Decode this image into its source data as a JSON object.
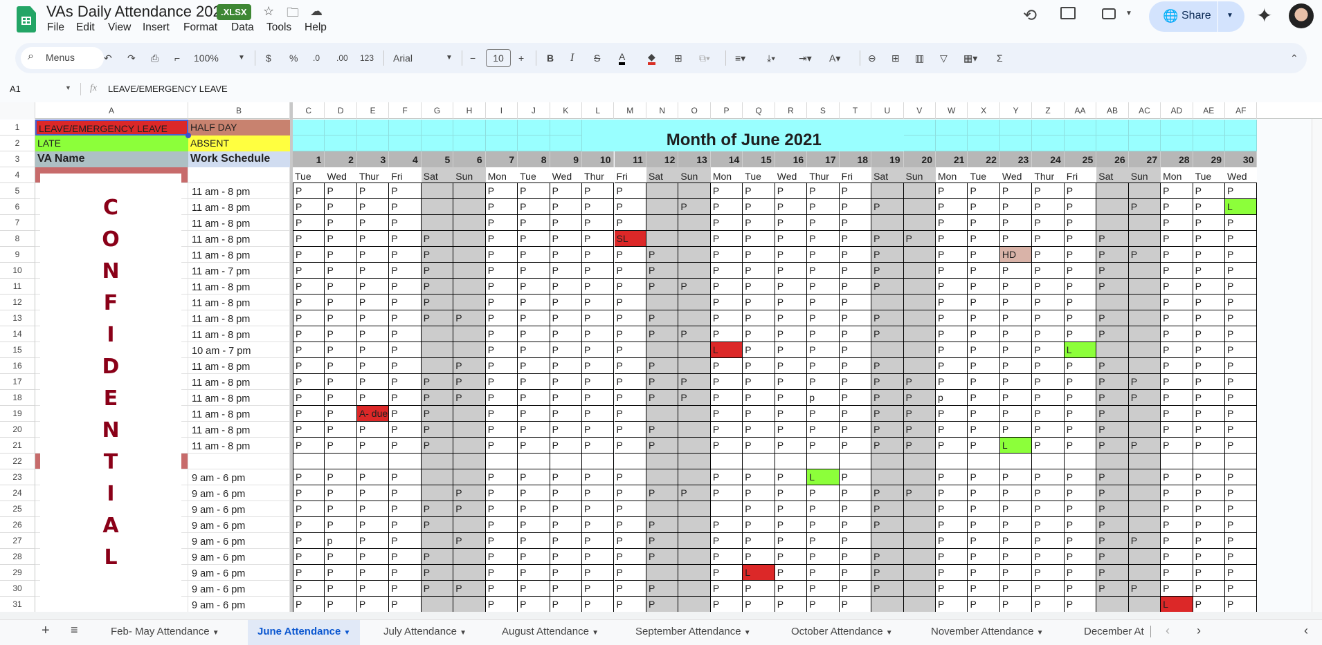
{
  "app": {
    "title": "VAs Daily Attendance 2021",
    "badge": ".XLSX",
    "menus": [
      "File",
      "Edit",
      "View",
      "Insert",
      "Format",
      "Data",
      "Tools",
      "Help"
    ],
    "share_label": "Share"
  },
  "toolbar": {
    "search_label": "Menus",
    "zoom": "100%",
    "currency": "$",
    "percent": "%",
    "decrease_decimal": ".0",
    "increase_decimal": ".00",
    "number_format": "123",
    "font": "Arial",
    "font_size": "10",
    "text_color": "#000000",
    "fill_color": "#d93025"
  },
  "formula_bar": {
    "cell_ref": "A1",
    "fx": "fx",
    "content": "LEAVE/EMERGENCY LEAVE"
  },
  "sheet": {
    "columns": [
      "A",
      "B",
      "C",
      "D",
      "E",
      "F",
      "G",
      "H",
      "I",
      "J",
      "K",
      "L",
      "M",
      "N",
      "O",
      "P",
      "Q",
      "R",
      "S",
      "T",
      "U",
      "V",
      "W",
      "X",
      "Y",
      "Z",
      "AA",
      "AB",
      "AC",
      "AD",
      "AE",
      "AF"
    ],
    "row_numbers": [
      "1",
      "2",
      "3",
      "4",
      "5",
      "6",
      "7",
      "8",
      "9",
      "10",
      "11",
      "12",
      "13",
      "14",
      "15",
      "16",
      "17",
      "18",
      "19",
      "20",
      "21",
      "22",
      "23",
      "24",
      "25",
      "26",
      "27",
      "28",
      "29",
      "30",
      "31"
    ],
    "legend": {
      "a1": "LEAVE/EMERGENCY LEAVE",
      "b1": "HALF DAY",
      "a2": "LATE",
      "b2": "ABSENT"
    },
    "headers": {
      "va_name": "VA Name",
      "work_schedule": "Work Schedule"
    },
    "title": "Month of June 2021",
    "days": [
      "1",
      "2",
      "3",
      "4",
      "5",
      "6",
      "7",
      "8",
      "9",
      "10",
      "11",
      "12",
      "13",
      "14",
      "15",
      "16",
      "17",
      "18",
      "19",
      "20",
      "21",
      "22",
      "23",
      "24",
      "25",
      "26",
      "27",
      "28",
      "29",
      "30"
    ],
    "weekdays": [
      "Tue",
      "Wed",
      "Thur",
      "Fri",
      "Sat",
      "Sun",
      "Mon",
      "Tue",
      "Wed",
      "Thur",
      "Fri",
      "Sat",
      "Sun",
      "Mon",
      "Tue",
      "Wed",
      "Thur",
      "Fri",
      "Sat",
      "Sun",
      "Mon",
      "Tue",
      "Wed",
      "Thur",
      "Fri",
      "Sat",
      "Sun",
      "Mon",
      "Tue",
      "Wed"
    ],
    "schedules": [
      "",
      "11 am - 8 pm",
      "11 am - 8 pm",
      "11 am - 8 pm",
      "11 am - 8 pm",
      "11 am - 8 pm",
      "11 am - 7 pm",
      "11 am - 8 pm",
      "11 am - 8 pm",
      "11 am - 8 pm",
      "11 am - 8 pm",
      "10 am - 7 pm",
      "11 am - 8 pm",
      "11 am - 8 pm",
      "11 am - 8 pm",
      "11 am - 8 pm",
      "11 am - 8 pm",
      "11 am - 8 pm",
      "",
      "9 am - 6 pm",
      "9 am - 6 pm",
      "9 am - 6 pm",
      "9 am - 6 pm",
      "9 am - 6 pm",
      "9 am - 6 pm",
      "9 am - 6 pm",
      "9 am - 6 pm",
      "9 am - 6 pm"
    ],
    "attendance": [
      [
        "P",
        "P",
        "P",
        "P",
        "",
        "",
        "P",
        "P",
        "P",
        "P",
        "P",
        "",
        "",
        "P",
        "P",
        "P",
        "P",
        "P",
        "",
        "",
        "P",
        "P",
        "P",
        "P",
        "P",
        "",
        "",
        "P",
        "P",
        "P"
      ],
      [
        "P",
        "P",
        "P",
        "P",
        "",
        "",
        "P",
        "P",
        "P",
        "P",
        "P",
        "",
        "P",
        "P",
        "P",
        "P",
        "P",
        "P",
        "P",
        "",
        "P",
        "P",
        "P",
        "P",
        "P",
        "",
        "P",
        "P",
        "P",
        "L"
      ],
      [
        "P",
        "P",
        "P",
        "P",
        "",
        "",
        "P",
        "P",
        "P",
        "P",
        "P",
        "",
        "",
        "P",
        "P",
        "P",
        "P",
        "P",
        "",
        "",
        "P",
        "P",
        "P",
        "P",
        "P",
        "",
        "",
        "P",
        "P",
        "P"
      ],
      [
        "P",
        "P",
        "P",
        "P",
        "P",
        "",
        "P",
        "P",
        "P",
        "P",
        "SL",
        "",
        "",
        "P",
        "P",
        "P",
        "P",
        "P",
        "P",
        "P",
        "P",
        "P",
        "P",
        "P",
        "P",
        "P",
        "",
        "P",
        "P",
        "P"
      ],
      [
        "P",
        "P",
        "P",
        "P",
        "P",
        "",
        "P",
        "P",
        "P",
        "P",
        "P",
        "P",
        "",
        "P",
        "P",
        "P",
        "P",
        "P",
        "P",
        "",
        "P",
        "P",
        "HD",
        "P",
        "P",
        "P",
        "P",
        "P",
        "P",
        "P"
      ],
      [
        "P",
        "P",
        "P",
        "P",
        "P",
        "",
        "P",
        "P",
        "P",
        "P",
        "P",
        "P",
        "",
        "P",
        "P",
        "P",
        "P",
        "P",
        "P",
        "",
        "P",
        "P",
        "P",
        "P",
        "P",
        "P",
        "",
        "P",
        "P",
        "P"
      ],
      [
        "P",
        "P",
        "P",
        "P",
        "P",
        "",
        "P",
        "P",
        "P",
        "P",
        "P",
        "P",
        "P",
        "P",
        "P",
        "P",
        "P",
        "P",
        "P",
        "",
        "P",
        "P",
        "P",
        "P",
        "P",
        "P",
        "",
        "P",
        "P",
        "P"
      ],
      [
        "P",
        "P",
        "P",
        "P",
        "P",
        "",
        "P",
        "P",
        "P",
        "P",
        "P",
        "",
        "",
        "P",
        "P",
        "P",
        "P",
        "P",
        "",
        "",
        "P",
        "P",
        "P",
        "P",
        "P",
        "",
        "",
        "P",
        "P",
        "P"
      ],
      [
        "P",
        "P",
        "P",
        "P",
        "P",
        "P",
        "P",
        "P",
        "P",
        "P",
        "P",
        "P",
        "",
        "P",
        "P",
        "P",
        "P",
        "P",
        "P",
        "",
        "P",
        "P",
        "P",
        "P",
        "P",
        "P",
        "",
        "P",
        "P",
        "P"
      ],
      [
        "P",
        "P",
        "P",
        "P",
        "",
        "",
        "P",
        "P",
        "P",
        "P",
        "P",
        "P",
        "P",
        "P",
        "P",
        "P",
        "P",
        "P",
        "P",
        "",
        "P",
        "P",
        "P",
        "P",
        "P",
        "P",
        "",
        "P",
        "P",
        "P"
      ],
      [
        "P",
        "P",
        "P",
        "P",
        "",
        "",
        "P",
        "P",
        "P",
        "P",
        "P",
        "",
        "",
        "L",
        "P",
        "P",
        "P",
        "P",
        "",
        "",
        "P",
        "P",
        "P",
        "P",
        "L",
        "",
        "",
        "P",
        "P",
        "P"
      ],
      [
        "P",
        "P",
        "P",
        "P",
        "",
        "P",
        "P",
        "P",
        "P",
        "P",
        "P",
        "P",
        "",
        "P",
        "P",
        "P",
        "P",
        "P",
        "P",
        "",
        "P",
        "P",
        "P",
        "P",
        "P",
        "P",
        "",
        "P",
        "P",
        "P"
      ],
      [
        "P",
        "P",
        "P",
        "P",
        "P",
        "P",
        "P",
        "P",
        "P",
        "P",
        "P",
        "P",
        "P",
        "P",
        "P",
        "P",
        "P",
        "P",
        "P",
        "P",
        "P",
        "P",
        "P",
        "P",
        "P",
        "P",
        "P",
        "P",
        "P",
        "P"
      ],
      [
        "P",
        "P",
        "P",
        "P",
        "P",
        "P",
        "P",
        "P",
        "P",
        "P",
        "P",
        "P",
        "P",
        "P",
        "P",
        "P",
        "p",
        "P",
        "P",
        "P",
        "p",
        "P",
        "P",
        "P",
        "P",
        "P",
        "P",
        "P",
        "P",
        "P"
      ],
      [
        "P",
        "P",
        "A- due",
        "P",
        "P",
        "",
        "P",
        "P",
        "P",
        "P",
        "P",
        "",
        "",
        "P",
        "P",
        "P",
        "P",
        "P",
        "P",
        "P",
        "P",
        "P",
        "P",
        "P",
        "P",
        "P",
        "",
        "P",
        "P",
        "P"
      ],
      [
        "P",
        "P",
        "P",
        "P",
        "P",
        "",
        "P",
        "P",
        "P",
        "P",
        "P",
        "P",
        "",
        "P",
        "P",
        "P",
        "P",
        "P",
        "P",
        "P",
        "P",
        "P",
        "P",
        "P",
        "P",
        "P",
        "",
        "P",
        "P",
        "P"
      ],
      [
        "P",
        "P",
        "P",
        "P",
        "P",
        "",
        "P",
        "P",
        "P",
        "P",
        "P",
        "P",
        "",
        "P",
        "P",
        "P",
        "P",
        "P",
        "P",
        "P",
        "P",
        "P",
        "L",
        "P",
        "P",
        "P",
        "P",
        "P",
        "P",
        "P"
      ],
      [
        "",
        "",
        "",
        "",
        "",
        "",
        "",
        "",
        "",
        "",
        "",
        "",
        "",
        "",
        "",
        "",
        "",
        "",
        "",
        "",
        "",
        "",
        "",
        "",
        "",
        "",
        "",
        "",
        "",
        ""
      ],
      [
        "P",
        "P",
        "P",
        "P",
        "",
        "",
        "P",
        "P",
        "P",
        "P",
        "P",
        "",
        "",
        "P",
        "P",
        "P",
        "L",
        "P",
        "",
        "",
        "P",
        "P",
        "P",
        "P",
        "P",
        "P",
        "",
        "P",
        "P",
        "P"
      ],
      [
        "P",
        "P",
        "P",
        "P",
        "",
        "P",
        "P",
        "P",
        "P",
        "P",
        "P",
        "P",
        "P",
        "P",
        "P",
        "P",
        "P",
        "P",
        "P",
        "P",
        "P",
        "P",
        "P",
        "P",
        "P",
        "P",
        "",
        "P",
        "P",
        "P"
      ],
      [
        "P",
        "P",
        "P",
        "P",
        "P",
        "P",
        "P",
        "P",
        "P",
        "P",
        "P",
        "",
        "",
        "",
        "P",
        "P",
        "P",
        "P",
        "P",
        "",
        "P",
        "P",
        "P",
        "P",
        "P",
        "P",
        "",
        "P",
        "P",
        "P"
      ],
      [
        "P",
        "P",
        "P",
        "P",
        "P",
        "",
        "P",
        "P",
        "P",
        "P",
        "P",
        "P",
        "",
        "P",
        "P",
        "P",
        "P",
        "P",
        "P",
        "",
        "P",
        "P",
        "P",
        "P",
        "P",
        "P",
        "",
        "P",
        "P",
        "P"
      ],
      [
        "P",
        "p",
        "P",
        "P",
        "",
        "P",
        "P",
        "P",
        "P",
        "P",
        "P",
        "P",
        "",
        "P",
        "P",
        "P",
        "P",
        "P",
        "",
        "",
        "P",
        "P",
        "P",
        "P",
        "P",
        "P",
        "P",
        "P",
        "P",
        "P"
      ],
      [
        "P",
        "P",
        "P",
        "P",
        "P",
        "",
        "P",
        "P",
        "P",
        "P",
        "P",
        "P",
        "",
        "P",
        "P",
        "P",
        "P",
        "P",
        "P",
        "",
        "P",
        "P",
        "P",
        "P",
        "P",
        "P",
        "",
        "P",
        "P",
        "P"
      ],
      [
        "P",
        "P",
        "P",
        "P",
        "P",
        "",
        "P",
        "P",
        "P",
        "P",
        "P",
        "",
        "",
        "P",
        "L",
        "P",
        "P",
        "P",
        "P",
        "",
        "P",
        "P",
        "P",
        "P",
        "P",
        "P",
        "",
        "P",
        "P",
        "P"
      ],
      [
        "P",
        "P",
        "P",
        "P",
        "P",
        "P",
        "P",
        "P",
        "P",
        "P",
        "P",
        "P",
        "",
        "P",
        "P",
        "P",
        "P",
        "P",
        "P",
        "",
        "P",
        "P",
        "P",
        "P",
        "P",
        "P",
        "P",
        "P",
        "P",
        "P"
      ],
      [
        "P",
        "P",
        "P",
        "P",
        "",
        "",
        "P",
        "P",
        "P",
        "P",
        "P",
        "P",
        "",
        "P",
        "P",
        "P",
        "P",
        "P",
        "",
        "",
        "P",
        "P",
        "P",
        "P",
        "P",
        "",
        "",
        "L",
        "P",
        "P"
      ]
    ],
    "highlights": [
      {
        "row": 6,
        "day": 30,
        "status": "late"
      },
      {
        "row": 8,
        "day": 11,
        "status": "leave"
      },
      {
        "row": 9,
        "day": 23,
        "status": "half_day"
      },
      {
        "row": 15,
        "day": 14,
        "status": "leave"
      },
      {
        "row": 15,
        "day": 25,
        "status": "late"
      },
      {
        "row": 19,
        "day": 3,
        "status": "leave"
      },
      {
        "row": 21,
        "day": 23,
        "status": "late"
      },
      {
        "row": 23,
        "day": 17,
        "status": "late"
      },
      {
        "row": 29,
        "day": 15,
        "status": "leave"
      },
      {
        "row": 31,
        "day": 28,
        "status": "leave"
      }
    ],
    "colors": {
      "leave": "#dc2828",
      "late": "#8cff3a",
      "half_day": "#d9b3a8",
      "absent": "#ffff40",
      "half_day_legend": "#c8826f",
      "title_band": "#99ffff",
      "weekend": "#cccccc",
      "name_group": "#c76b6b"
    }
  },
  "confidential_stamp": "CONFIDENTIAL",
  "tabs": [
    "Feb- May Attendance",
    "June Attendance",
    "July Attendance",
    "August Attendance",
    "September Attendance",
    "October Attendance",
    "November Attendance",
    "December At"
  ],
  "active_tab": "June Attendance"
}
